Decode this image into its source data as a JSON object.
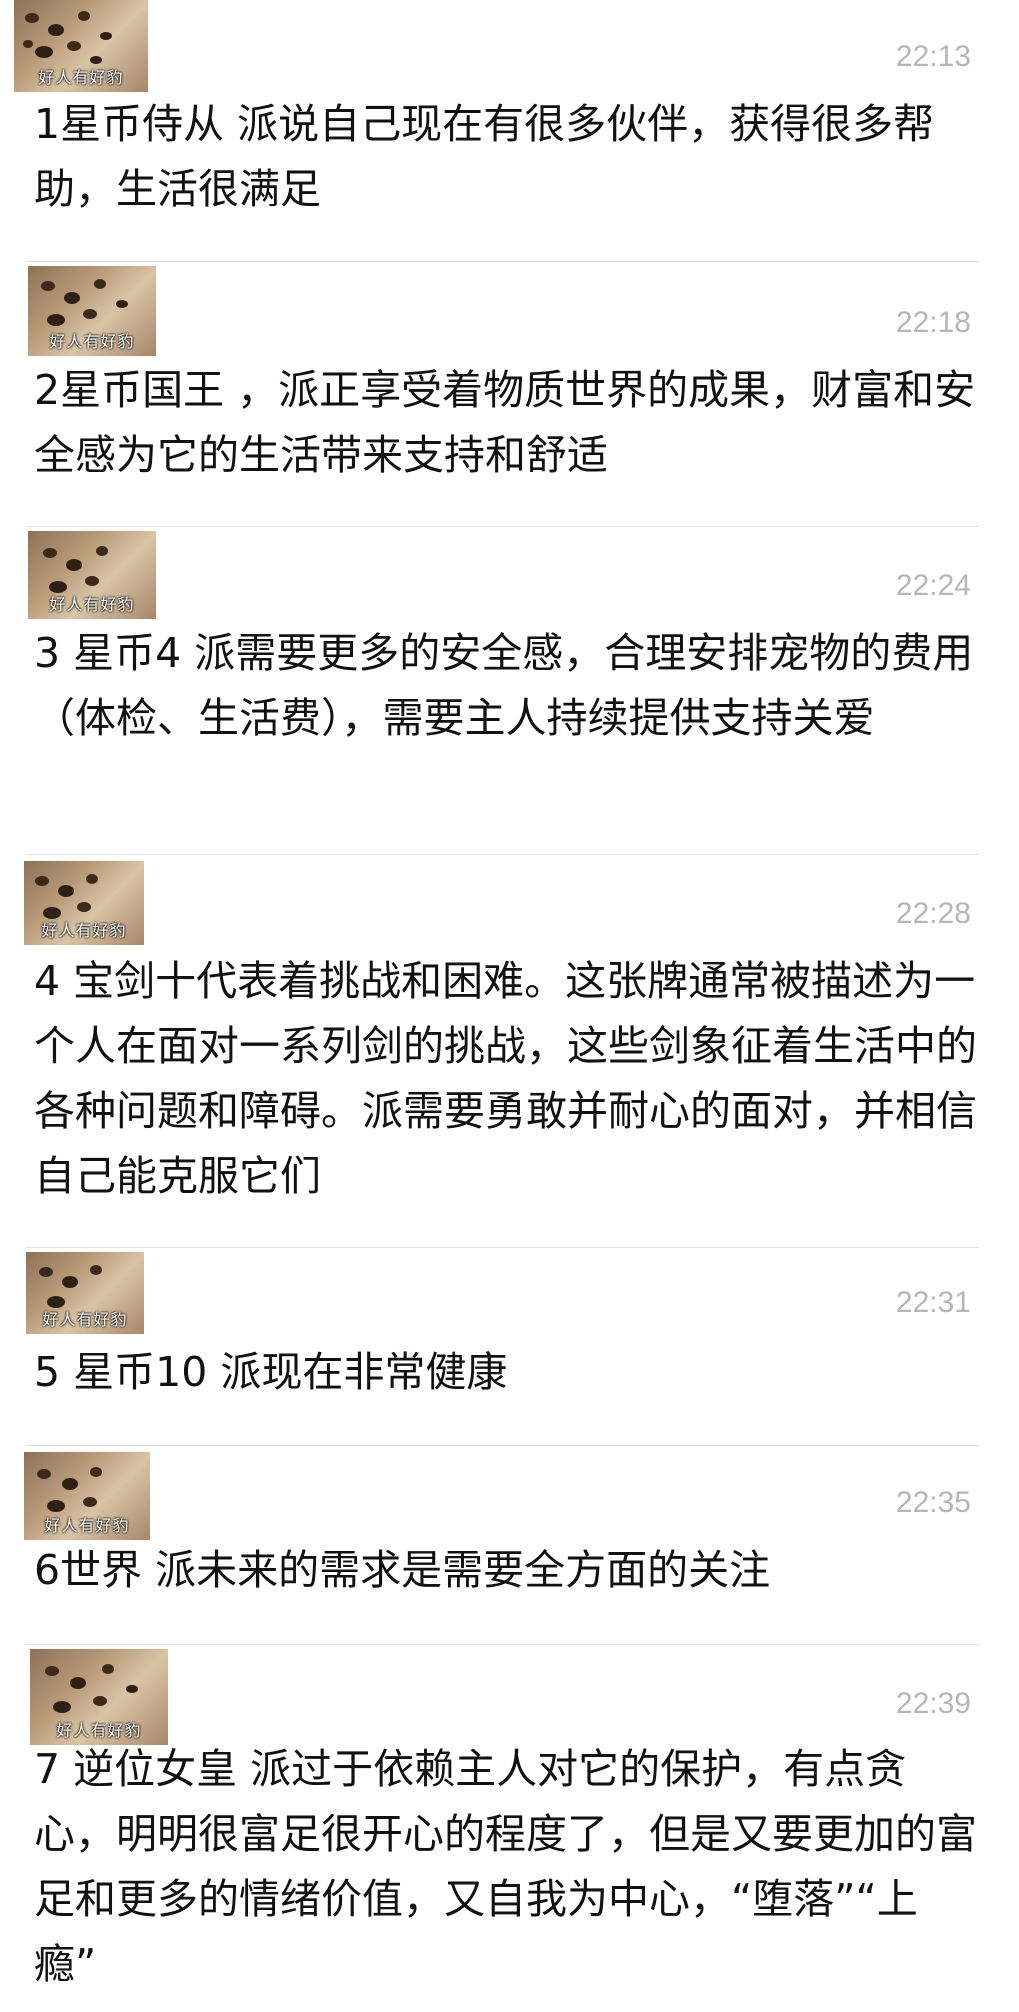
{
  "avatar_watermark": "好人有好豹",
  "messages": [
    {
      "time": "22:13",
      "text": "1星币侍从 派说自己现在有很多伙伴，获得很多帮助，生活很满足"
    },
    {
      "time": "22:18",
      "text": "2星币国王 ，派正享受着物质世界的成果，财富和安全感为它的生活带来支持和舒适"
    },
    {
      "time": "22:24",
      "text": "3 星币4  派需要更多的安全感，合理安排宠物的费用（体检、生活费），需要主人持续提供支持关爱"
    },
    {
      "time": "22:28",
      "text": "4 宝剑十代表着挑战和困难。这张牌通常被描述为一个人在面对一系列剑的挑战，这些剑象征着生活中的各种问题和障碍。派需要勇敢并耐心的面对，并相信自己能克服它们"
    },
    {
      "time": "22:31",
      "text": "5 星币10 派现在非常健康"
    },
    {
      "time": "22:35",
      "text": "6世界 派未来的需求是需要全方面的关注"
    },
    {
      "time": "22:39",
      "text": "7 逆位女皇 派过于依赖主人对它的保护，有点贪心，明明很富足很开心的程度了，但是又要更加的富足和更多的情绪价值，又自我为中心，“堕落”“上瘾”"
    }
  ]
}
